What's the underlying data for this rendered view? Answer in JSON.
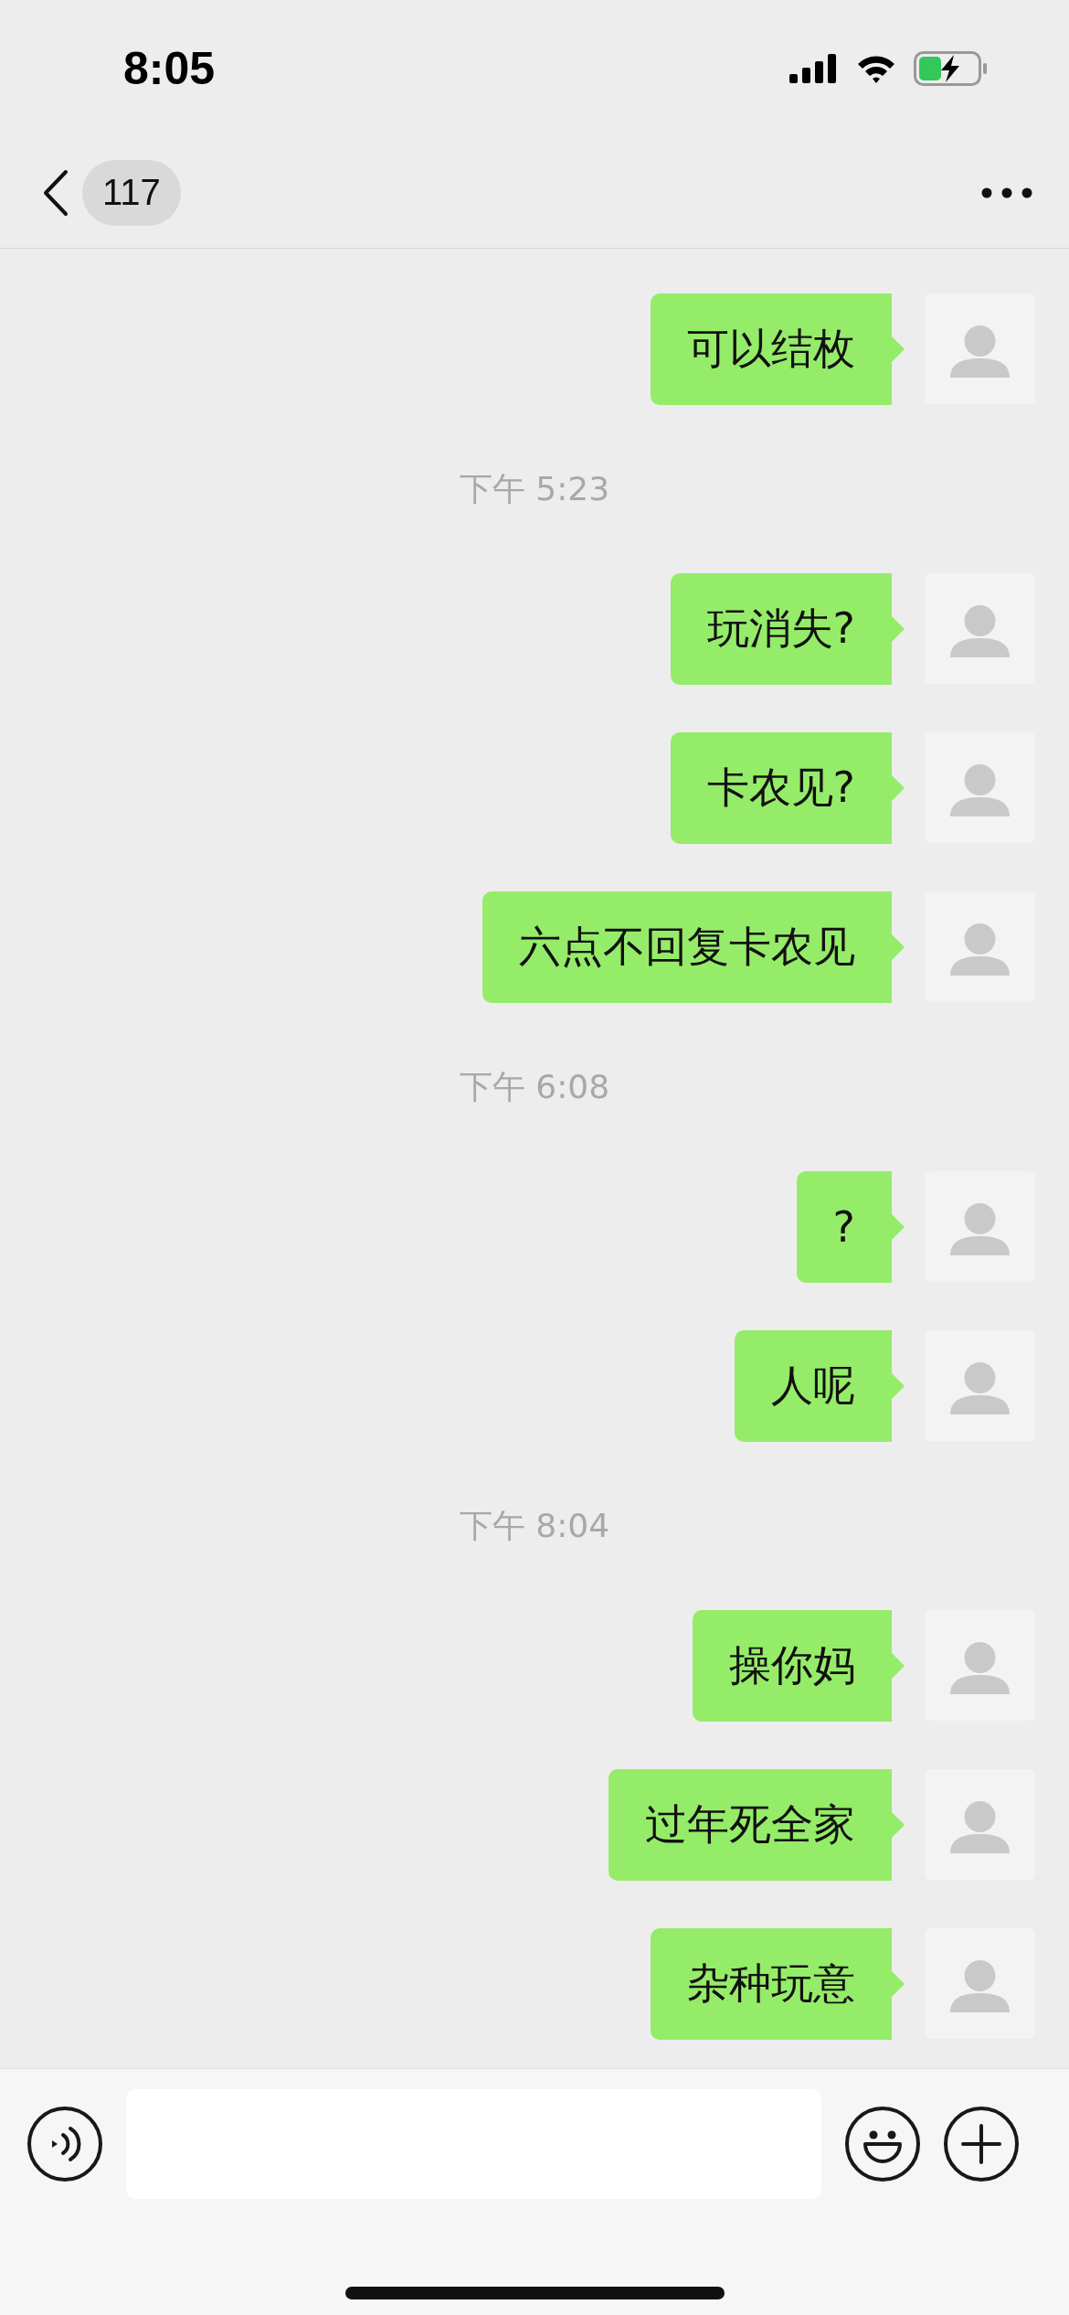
{
  "status_bar": {
    "time": "8:05"
  },
  "header": {
    "unread_count": "117"
  },
  "messages": [
    {
      "kind": "message",
      "text": "可以结枚"
    },
    {
      "kind": "timestamp",
      "text": "下午 5:23"
    },
    {
      "kind": "message",
      "text": "玩消失?"
    },
    {
      "kind": "message",
      "text": "卡农见?"
    },
    {
      "kind": "message",
      "text": "六点不回复卡农见"
    },
    {
      "kind": "timestamp",
      "text": "下午 6:08"
    },
    {
      "kind": "message",
      "text": "?"
    },
    {
      "kind": "message",
      "text": "人呢"
    },
    {
      "kind": "timestamp",
      "text": "下午 8:04"
    },
    {
      "kind": "message",
      "text": "操你妈"
    },
    {
      "kind": "message",
      "text": "过年死全家"
    },
    {
      "kind": "message",
      "text": "杂种玩意"
    }
  ]
}
